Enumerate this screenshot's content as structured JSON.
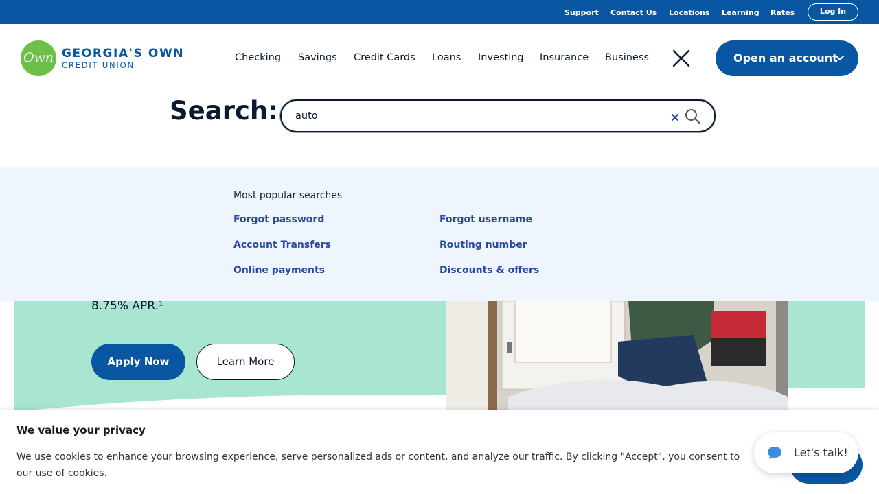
{
  "utility_nav": {
    "links": [
      "Support",
      "Contact Us",
      "Locations",
      "Learning",
      "Rates"
    ],
    "login": "Log In"
  },
  "brand": {
    "logo_mark": "Own",
    "line1": "GEORGIA'S OWN",
    "line2": "CREDIT UNION",
    "primary_color": "#0957a3",
    "logo_color": "#6cc04a"
  },
  "main_nav": {
    "items": [
      "Checking",
      "Savings",
      "Credit Cards",
      "Loans",
      "Investing",
      "Insurance",
      "Business"
    ],
    "close_icon": "close-icon",
    "cta": "Open an account"
  },
  "search": {
    "label": "Search:",
    "value": "auto"
  },
  "popular_searches": {
    "title": "Most popular searches",
    "left": [
      "Forgot password",
      "Account Transfers",
      "Online payments"
    ],
    "right": [
      "Forgot username",
      "Routing number",
      "Discounts & offers"
    ]
  },
  "hero": {
    "apr_text": "8.75% APR.¹",
    "apply_label": "Apply Now",
    "learn_label": "Learn More"
  },
  "cookie_banner": {
    "title": "We value your privacy",
    "text": "We use cookies to enhance your browsing experience, serve personalized ads or content, and analyze our traffic. By clicking \"Accept\", you consent to our use of cookies."
  },
  "chat": {
    "label": "Let's talk!"
  }
}
